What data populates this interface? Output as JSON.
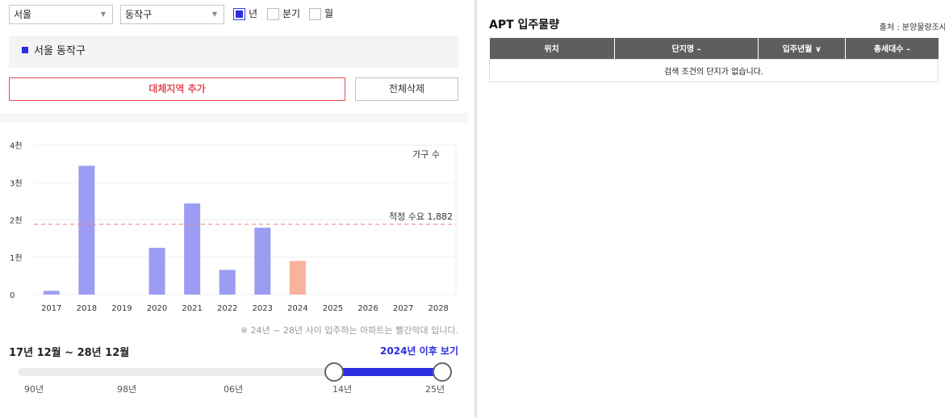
{
  "filters": {
    "city": "서울",
    "district": "동작구",
    "period_options": [
      {
        "label": "년",
        "checked": true
      },
      {
        "label": "분기",
        "checked": false
      },
      {
        "label": "월",
        "checked": false
      }
    ]
  },
  "region": {
    "label": "서울 동작구",
    "color": "#2c2ce0"
  },
  "buttons": {
    "add": "대체지역 추가",
    "delete_all": "전체삭제"
  },
  "chart_data": {
    "type": "bar",
    "categories": [
      "2017",
      "2018",
      "2019",
      "2020",
      "2021",
      "2022",
      "2023",
      "2024",
      "2025",
      "2026",
      "2027",
      "2028"
    ],
    "values": [
      100,
      3450,
      0,
      1250,
      2440,
      660,
      1790,
      900,
      0,
      0,
      0,
      0
    ],
    "bar_colors": [
      "#9c9cf3",
      "#9c9cf3",
      "#9c9cf3",
      "#9c9cf3",
      "#9c9cf3",
      "#9c9cf3",
      "#9c9cf3",
      "#f7b39c",
      "#f7b39c",
      "#f7b39c",
      "#f7b39c",
      "#f7b39c"
    ],
    "ylim": [
      0,
      4000
    ],
    "yticks": [
      {
        "value": 0,
        "label": "0"
      },
      {
        "value": 1000,
        "label": "1천"
      },
      {
        "value": 2000,
        "label": "2천"
      },
      {
        "value": 3000,
        "label": "3천"
      },
      {
        "value": 4000,
        "label": "4천"
      }
    ],
    "unit_label": "가구 수",
    "reference_line": {
      "value": 1882,
      "label": "적정 수요 1,882",
      "color": "#f08a8a"
    },
    "grid": true
  },
  "note": "※ 24년 ~ 28년 사이 입주하는 아파트는 빨간막대 입니다.",
  "period_range": "17년 12월 ~ 28년 12월",
  "after_link": "2024년 이후 보기",
  "slider": {
    "ticks": [
      "90년",
      "98년",
      "06년",
      "14년",
      "25년"
    ],
    "start_fraction": 0.746,
    "end_fraction": 1.0,
    "color": "#2c2ce0"
  },
  "apt": {
    "title": "APT 입주물량",
    "source": "출처 : 분양물량조사",
    "columns": [
      "위치",
      "단지명 –",
      "입주년월 ∨",
      "총세대수 –"
    ],
    "empty_message": "검색 조건의 단지가 없습니다."
  }
}
